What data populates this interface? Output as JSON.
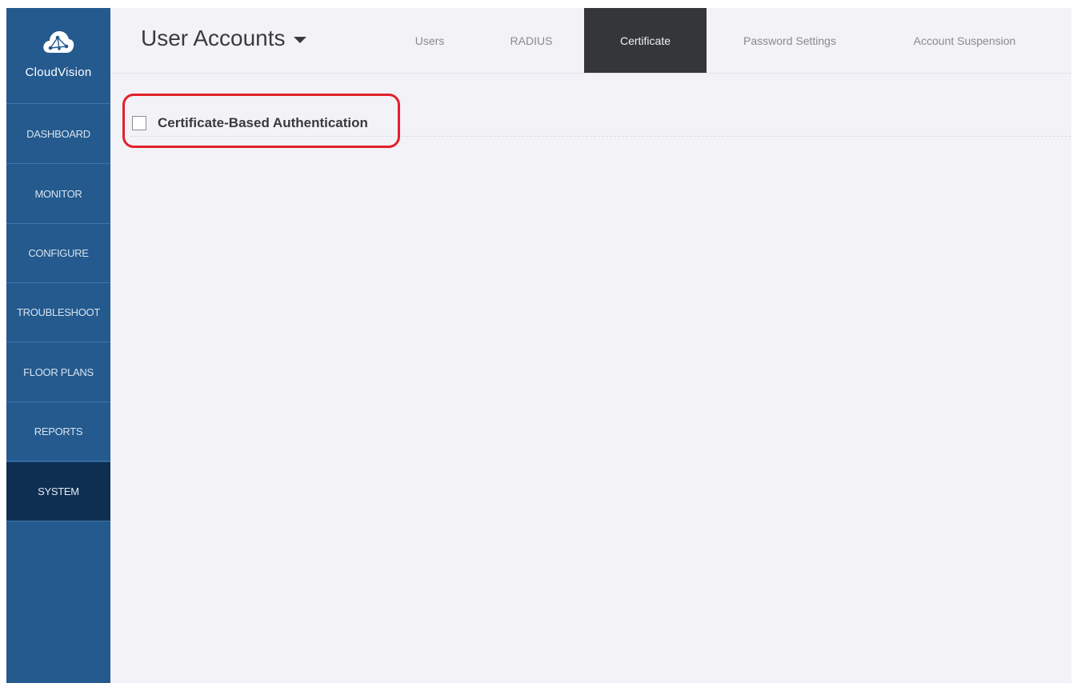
{
  "app": {
    "logo_text": "CloudVision"
  },
  "sidebar": {
    "items": [
      {
        "label": "DASHBOARD"
      },
      {
        "label": "MONITOR"
      },
      {
        "label": "CONFIGURE"
      },
      {
        "label": "TROUBLESHOOT"
      },
      {
        "label": "FLOOR PLANS"
      },
      {
        "label": "REPORTS"
      },
      {
        "label": "SYSTEM",
        "active": true
      }
    ]
  },
  "header": {
    "title": "User Accounts",
    "tabs": [
      {
        "label": "Users"
      },
      {
        "label": "RADIUS"
      },
      {
        "label": "Certificate",
        "active": true
      },
      {
        "label": "Password Settings"
      },
      {
        "label": "Account Suspension"
      }
    ]
  },
  "content": {
    "option_label": "Certificate-Based Authentication",
    "option_checked": false
  },
  "colors": {
    "sidebar_bg": "#245a8e",
    "sidebar_active": "#0f2f52",
    "tab_active": "#35363a",
    "highlight": "#e3202a",
    "content_bg": "#f3f2f7"
  },
  "icons": {
    "logo": "cloud-network-icon",
    "title_dropdown": "caret-down-icon"
  }
}
